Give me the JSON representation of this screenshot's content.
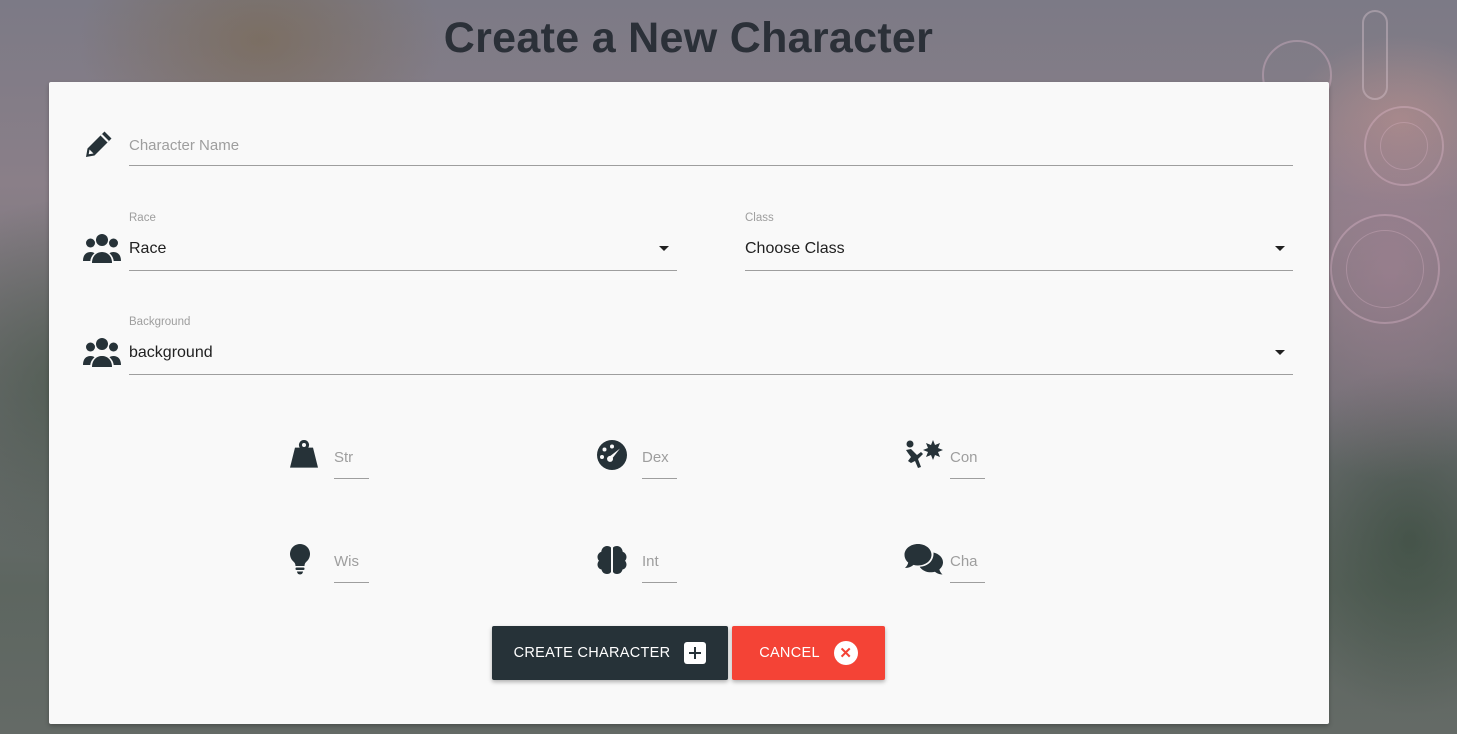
{
  "page": {
    "title": "Create a New Character"
  },
  "form": {
    "name": {
      "placeholder": "Character Name",
      "icon": "pencil-icon"
    },
    "race": {
      "label": "Race",
      "value": "Race",
      "icon": "users-icon"
    },
    "class": {
      "label": "Class",
      "value": "Choose Class"
    },
    "background": {
      "label": "Background",
      "value": "background",
      "icon": "users-icon"
    },
    "stats": [
      {
        "placeholder": "Str",
        "icon": "weight-icon"
      },
      {
        "placeholder": "Dex",
        "icon": "tachometer-icon"
      },
      {
        "placeholder": "Con",
        "icon": "person-falling-burst-icon"
      },
      {
        "placeholder": "Wis",
        "icon": "lightbulb-icon"
      },
      {
        "placeholder": "Int",
        "icon": "brain-icon"
      },
      {
        "placeholder": "Cha",
        "icon": "comments-icon"
      }
    ]
  },
  "buttons": {
    "create": {
      "label": "CREATE CHARACTER",
      "icon": "plus-square-icon",
      "color": "#263238"
    },
    "cancel": {
      "label": "CANCEL",
      "icon": "close-circle-icon",
      "color": "#f44336"
    }
  }
}
